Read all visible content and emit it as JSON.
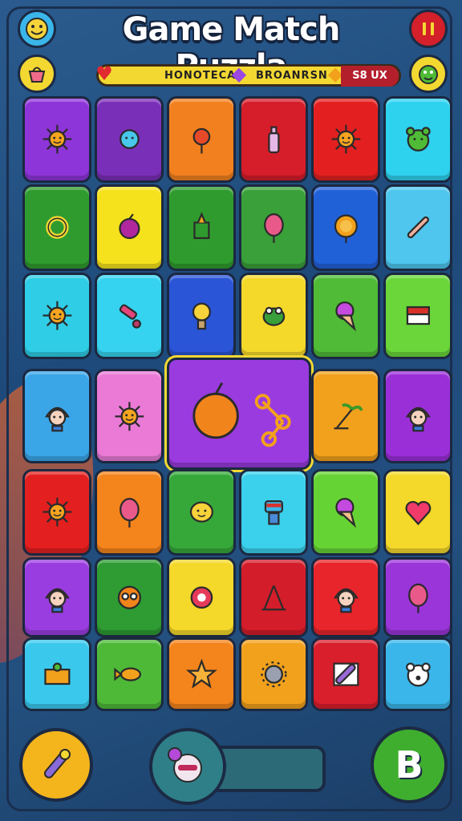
{
  "header": {
    "title": "Game Match Puzzla",
    "left_top_icon": "smiley-face-icon",
    "left_second_icon": "basket-icon",
    "right_top_icon": "pause-icon",
    "right_second_icon": "green-monster-icon"
  },
  "scorebar": {
    "label_1": "HONOTECA",
    "label_2": "BROANRSN",
    "label_3": "S8 UX",
    "gem_1_icon": "heart-icon",
    "gem_2_icon": "purple-gem-icon",
    "gem_3_icon": "gold-gem-icon"
  },
  "board": {
    "tiles": [
      {
        "color": "#8e35d9",
        "icon": "sun-icon"
      },
      {
        "color": "#7a2fb8",
        "icon": "blue-virus-icon"
      },
      {
        "color": "#f2801e",
        "icon": "flower-icon"
      },
      {
        "color": "#d61d2a",
        "icon": "bottle-icon"
      },
      {
        "color": "#e3201f",
        "icon": "sun-icon"
      },
      {
        "color": "#2ed2ef",
        "icon": "green-bear-icon"
      },
      {
        "color": "#2f9b2e",
        "icon": "ring-icon"
      },
      {
        "color": "#f5e21c",
        "icon": "fruit-icon"
      },
      {
        "color": "#2f9b2e",
        "icon": "lantern-icon"
      },
      {
        "color": "#3aa03a",
        "icon": "balloon-icon"
      },
      {
        "color": "#2161d8",
        "icon": "lion-icon"
      },
      {
        "color": "#4ec6ee",
        "icon": "wrench-icon"
      },
      {
        "color": "#2fcde6",
        "icon": "sun-icon"
      },
      {
        "color": "#36d3f0",
        "icon": "key-icon"
      },
      {
        "color": "#2a55d6",
        "icon": "bulb-icon"
      },
      {
        "color": "#f4d82a",
        "icon": "frog-icon"
      },
      {
        "color": "#4fbb36",
        "icon": "ice-cream-icon"
      },
      {
        "color": "#6ad63a",
        "icon": "book-icon"
      },
      {
        "color": "#3aa6e8",
        "icon": "girl-face-icon"
      },
      {
        "color": "#ea7ad6",
        "icon": "sun-icon"
      },
      {
        "color": "#f2a11c",
        "icon": "palm-tree-icon"
      },
      {
        "color": "#9a2fd8",
        "icon": "girl-face-icon"
      },
      {
        "color": "#e3201f",
        "icon": "sun-face-icon"
      },
      {
        "color": "#f4841c",
        "icon": "balloon-icon"
      },
      {
        "color": "#36a83a",
        "icon": "lemon-face-icon"
      },
      {
        "color": "#3bd0ec",
        "icon": "robot-icon"
      },
      {
        "color": "#66d335",
        "icon": "ice-cream-icon"
      },
      {
        "color": "#f4d82a",
        "icon": "heart-icon"
      },
      {
        "color": "#9a3de0",
        "icon": "boy-face-icon"
      },
      {
        "color": "#2e9b33",
        "icon": "glasses-face-icon"
      },
      {
        "color": "#f4d82a",
        "icon": "gem-icon"
      },
      {
        "color": "#d41d2a",
        "icon": "compass-icon"
      },
      {
        "color": "#e8252a",
        "icon": "cat-face-icon"
      },
      {
        "color": "#9a35d9",
        "icon": "balloon-icon"
      },
      {
        "color": "#3ac9ed",
        "icon": "basket-icon"
      },
      {
        "color": "#4eb937",
        "icon": "fish-icon"
      },
      {
        "color": "#f4841c",
        "icon": "star-face-icon"
      },
      {
        "color": "#f2a11c",
        "icon": "spiky-ball-icon"
      },
      {
        "color": "#d91f2c",
        "icon": "brush-icon"
      },
      {
        "color": "#3ab6ea",
        "icon": "bear-face-icon"
      }
    ],
    "highlight": {
      "color": "#9a3be0",
      "icon": "orange-fruit-icon",
      "icon2": "chain-icon"
    }
  },
  "footer": {
    "left_button_icon": "wrench-icon",
    "power_icon": "monster-icon",
    "power_fill": 0.0,
    "right_button_icon": "coin-icon",
    "coin_label": "B"
  },
  "colors": {
    "accent_yellow": "#f4d832",
    "pause_red": "#d3202a",
    "coin_green": "#3fae2e"
  }
}
